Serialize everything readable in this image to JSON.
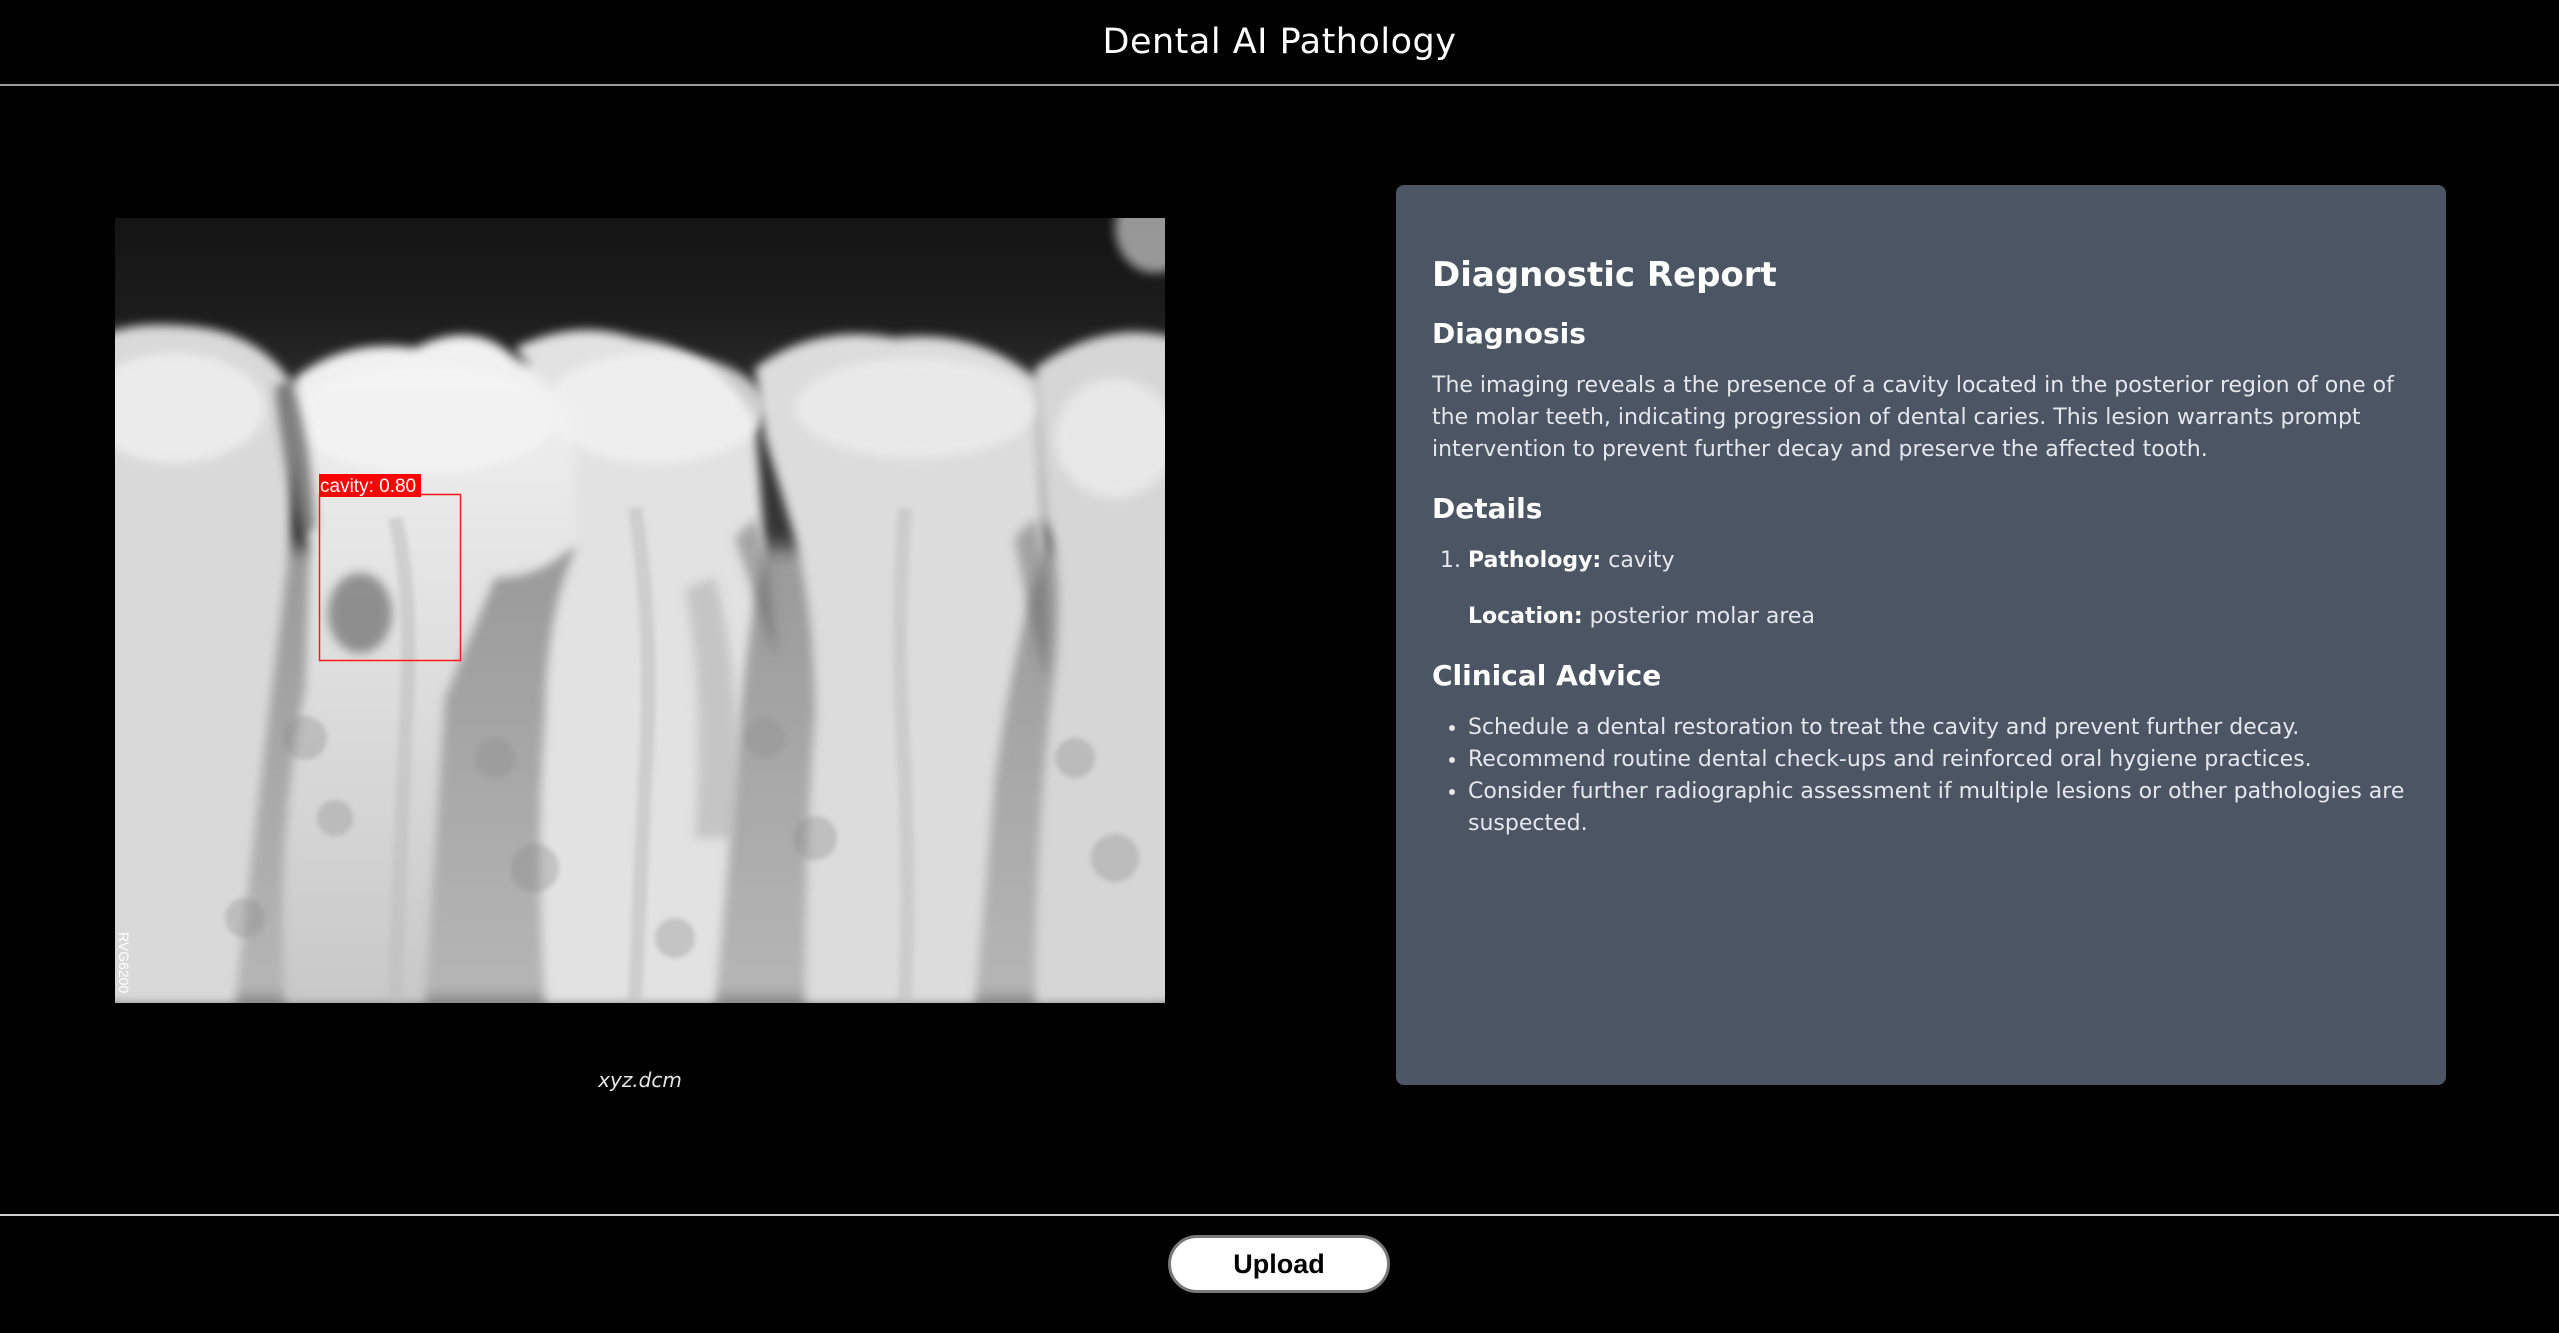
{
  "app": {
    "title": "Dental AI Pathology"
  },
  "viewer": {
    "file_name": "xyz.dcm",
    "sensor_label": "RVG6200",
    "detection": {
      "label": "cavity: 0.80",
      "class": "cavity",
      "confidence": 0.8
    },
    "colors": {
      "box": "#ff1a1a",
      "label_bg": "#ff0000",
      "label_text": "#ffffff"
    }
  },
  "report": {
    "title": "Diagnostic Report",
    "diagnosis": {
      "heading": "Diagnosis",
      "text": "The imaging reveals a the presence of a cavity located in the posterior region of one of the molar teeth, indicating progression of dental caries. This lesion warrants prompt intervention to prevent further decay and preserve the affected tooth."
    },
    "details": {
      "heading": "Details",
      "items": [
        {
          "pathology_label": "Pathology:",
          "pathology_value": "cavity",
          "location_label": "Location:",
          "location_value": "posterior molar area"
        }
      ]
    },
    "clinical_advice": {
      "heading": "Clinical Advice",
      "items": [
        "Schedule a dental restoration to treat the cavity and prevent further decay.",
        "Recommend routine dental check-ups and reinforced oral hygiene practices.",
        "Consider further radiographic assessment if multiple lesions or other pathologies are suspected."
      ]
    },
    "colors": {
      "card_bg": "#4b5563"
    }
  },
  "footer": {
    "upload_label": "Upload"
  }
}
